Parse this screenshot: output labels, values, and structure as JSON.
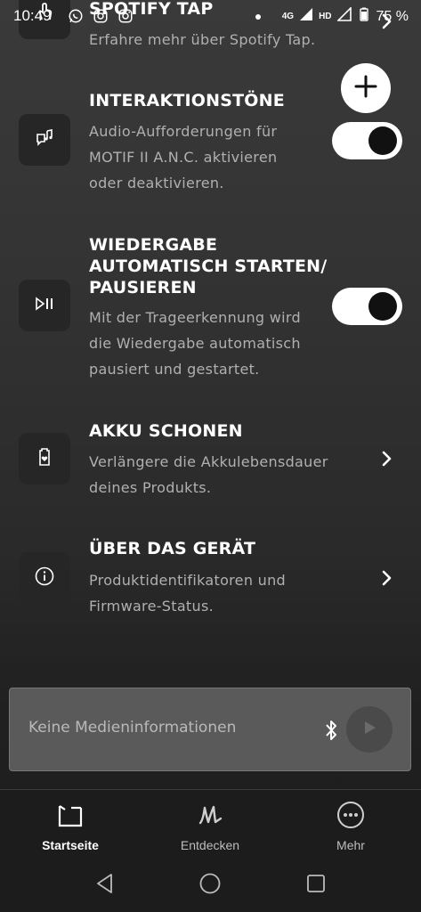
{
  "status_bar": {
    "time": "10:49",
    "network": "4G",
    "hd": "HD",
    "battery": "75 %"
  },
  "rows": [
    {
      "id": "spotify-tap",
      "title": "SPOTIFY TAP",
      "description": "Erfahre mehr über Spotify Tap.",
      "icon": "touch-icon",
      "control": "chevron"
    },
    {
      "id": "interaktionstoene",
      "title": "INTERAKTIONSTÖNE",
      "description_lines": [
        "Audio-Aufforderungen für",
        "MOTIF II A.N.C. aktivieren",
        "oder deaktivieren."
      ],
      "icon": "speech-music-icon",
      "control": "toggle",
      "toggle_on": true
    },
    {
      "id": "autoplay",
      "title_lines": [
        "WIEDERGABE",
        "AUTOMATISCH STARTEN/",
        "PAUSIEREN"
      ],
      "description_lines": [
        "Mit der Trageerkennung wird",
        "die Wiedergabe automatisch",
        "pausiert und gestartet."
      ],
      "icon": "play-pause-icon",
      "control": "toggle",
      "toggle_on": true
    },
    {
      "id": "akku",
      "title": "AKKU SCHONEN",
      "description_lines": [
        "Verlängere die Akkulebensdauer",
        "deines Produkts."
      ],
      "icon": "battery-heart-icon",
      "control": "chevron"
    },
    {
      "id": "ueber",
      "title": "ÜBER DAS GERÄT",
      "description_lines": [
        "Produktidentifikatoren und",
        "Firmware-Status."
      ],
      "icon": "info-icon",
      "control": "chevron"
    }
  ],
  "media": {
    "text": "Keine Medieninformationen"
  },
  "bottom_nav": [
    {
      "label": "Startseite",
      "icon": "home-icon",
      "active": true
    },
    {
      "label": "Entdecken",
      "icon": "marshall-m-icon",
      "active": false
    },
    {
      "label": "Mehr",
      "icon": "more-icon",
      "active": false
    }
  ],
  "colors": {
    "background_top": "#3a3a3a",
    "background_bottom": "#1c1c1c",
    "icon_tile": "#262626",
    "description_text": "#b0b0b0",
    "toggle_track": "#ffffff",
    "toggle_knob": "#111111"
  }
}
